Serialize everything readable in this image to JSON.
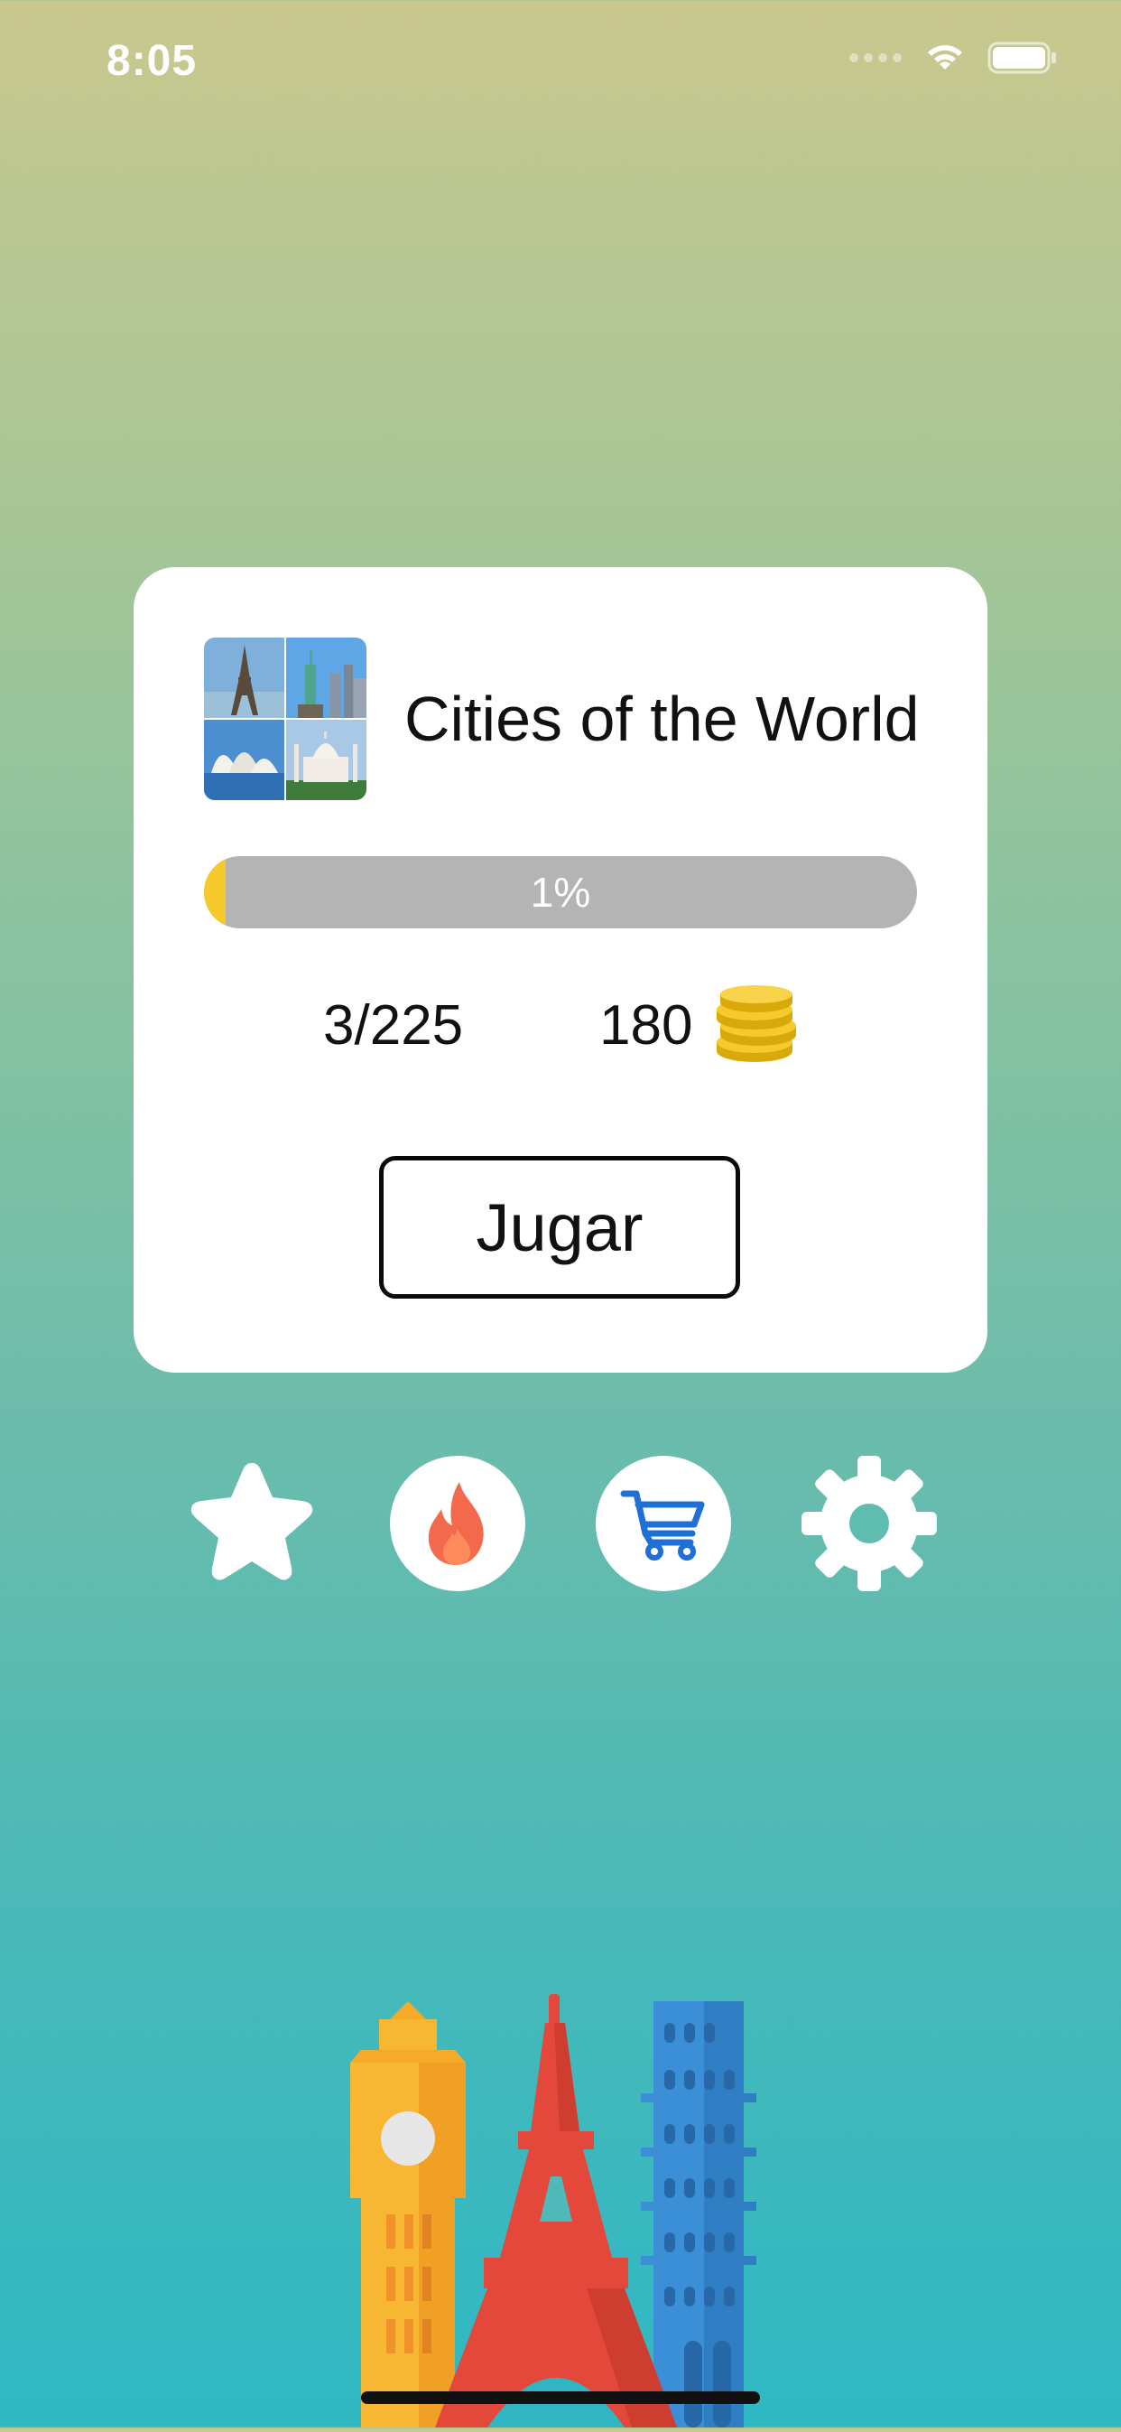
{
  "status_bar": {
    "time": "8:05"
  },
  "pack": {
    "title": "Cities of the World",
    "progress_label": "1%",
    "progress_fraction": 0.01,
    "solved": "3/225",
    "coins": "180"
  },
  "actions": {
    "play_label": "Jugar"
  },
  "toolbar": [
    {
      "icon": "star-icon"
    },
    {
      "icon": "flame-icon"
    },
    {
      "icon": "cart-icon"
    },
    {
      "icon": "gear-icon"
    }
  ],
  "colors": {
    "progress_fill": "#f6c92c",
    "progress_track": "#b4b4b4",
    "flame": "#f05a3c",
    "cart": "#1f6fd6"
  }
}
